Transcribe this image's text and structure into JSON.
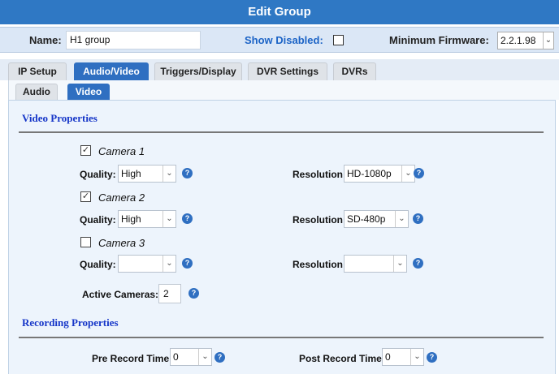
{
  "dialog": {
    "title": "Edit Group"
  },
  "header": {
    "name_label": "Name:",
    "name_value": "H1 group",
    "show_disabled_label": "Show Disabled:",
    "show_disabled_checked": false,
    "min_firmware_label": "Minimum Firmware:",
    "min_firmware_value": "2.2.1.98"
  },
  "tabs": [
    {
      "label": "IP Setup",
      "active": false
    },
    {
      "label": "Audio/Video",
      "active": true
    },
    {
      "label": "Triggers/Display",
      "active": false
    },
    {
      "label": "DVR Settings",
      "active": false
    },
    {
      "label": "DVRs",
      "active": false
    }
  ],
  "subtabs": [
    {
      "label": "Audio",
      "active": false
    },
    {
      "label": "Video",
      "active": true
    }
  ],
  "video": {
    "section_title": "Video Properties",
    "quality_label": "Quality:",
    "resolution_label": "Resolution:",
    "cameras": [
      {
        "label": "Camera 1",
        "checked": true,
        "quality": "High",
        "resolution": "HD-1080p"
      },
      {
        "label": "Camera 2",
        "checked": true,
        "quality": "High",
        "resolution": "SD-480p"
      },
      {
        "label": "Camera 3",
        "checked": false,
        "quality": "",
        "resolution": ""
      }
    ],
    "active_cameras_label": "Active Cameras:",
    "active_cameras_value": "2"
  },
  "recording": {
    "section_title": "Recording Properties",
    "pre_label": "Pre Record Time:",
    "pre_value": "0",
    "post_label": "Post Record Time:",
    "post_value": "0"
  },
  "colors": {
    "accent": "#2f6fc1",
    "title_bar": "#2f78c4",
    "section_title": "#1636c8",
    "panel_bg": "#edf4fc"
  }
}
